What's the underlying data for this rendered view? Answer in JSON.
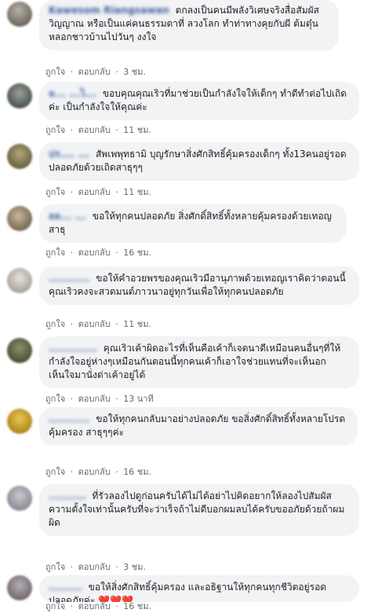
{
  "actions": {
    "like": "ถูกใจ",
    "reply": "ตอบกลับ",
    "separator": "·"
  },
  "comments": [
    {
      "author": "Kawesom Riangsawan",
      "text": "ตกลงเป็นคนมีพลังวิเศษจริงสื่อสัมผัสวิญญาณ หรือเป็นแค่คนธรรมดาที่ ลวงโลก ทำท่าทางคุยกับผี ต้มตุ๋น หลอกชาวบ้านไปวันๆ งงใจ",
      "time": "3 ชม."
    },
    {
      "author": "ล... ...ไ...",
      "text": "ขอบคุณคุณเริวที่มาช่วยเป็นกำลังใจให้เด็กๆ ทำดีทำต่อไปเถิดค่ะ เป็นกำลังใจให้คุณค่ะ",
      "time": "11 ชม."
    },
    {
      "author": "ปร.... ...",
      "text": "สัพเพพุทธามิ บุญรักษาสิ่งศักสิทธิ์คุ้มครองเด็กๆ ทั้ง13คนอยู่รอดปลอดภัยด้วยเถิดสาธุๆๆ",
      "time": "11 ชม."
    },
    {
      "author": "ลล... ...",
      "text": "ขอให้ทุกคนปลอดภัย สิ่งศักดิ์สิทธิ์ทั้งหลายคุ้มครองด้วยเทอญสาธุ",
      "time": "16 ชม."
    },
    {
      "author": "...........",
      "text": "ขอให้คำอวยพรของคุณเริวมีอานุภาพด้วยเทอญเราคิดว่าตอนนี้คุณเริวคงจะสวดมนต์ภาวนาอยู่ทุกวันเพื่อให้ทุกคนปลอดภัย",
      "time": "11 ชม."
    },
    {
      "author": ".............",
      "text": "คุณเริวเค้าผิดอะไรที่เห็นคือเค้าก็เจตนาดีเหมือนคนอื่นๆที่ให้กำลังใจอยู่ห่างๆเหมือนกันตอนนี้ทุกคนเค้าก็เอาใจช่วยแทนที่จะเห็นอกเห็นใจมานั่งด่าเค้าอยู่ได้",
      "time": "13 นาที"
    },
    {
      "author": "...........",
      "text": "ขอให้ทุกคนกลับมาอย่างปลอดภัย ขอสิ่งศักดิ์สิทธิ์ทั้งหลายโปรดคุ้มครอง สาธุๆๆค่ะ",
      "time": "16 ชม."
    },
    {
      "author": "..........",
      "text": "ที่รัวลองไปดูก่อนครับได้ไม่ได้อย่าไปคิดอยากให้ลองไปสัมผัสความตั้งใจเท่านั้นครับที่จะว่าเร็จถ้าไม่ดีบอกผมลบได้ครับขออภัยด้วยถ้าผมผิด",
      "time": "3 ชม."
    },
    {
      "author": ".........",
      "text": "ขอให้สิ่งศักสิทธิ์คุ้มครอง และอธิฐานให้ทุกคนทุกชีวิตอยู่รอดปลอดภัยค่ะ",
      "hearts": "❤️❤️❤️",
      "time": "16 ชม."
    }
  ]
}
